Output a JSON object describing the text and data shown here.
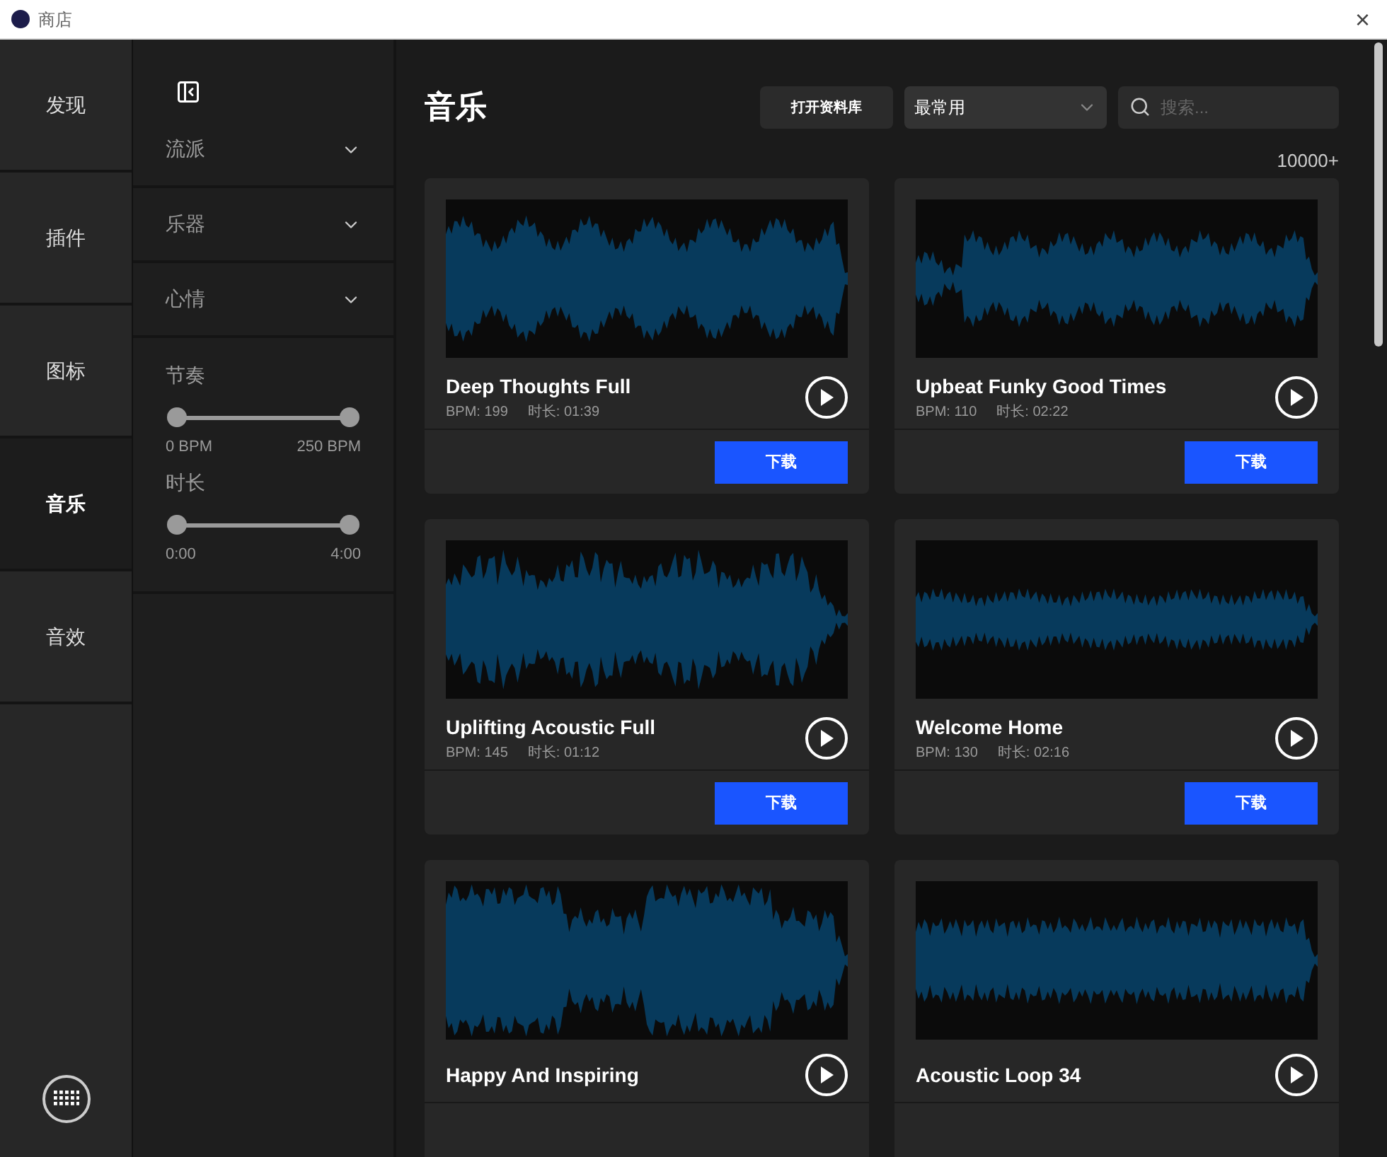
{
  "window": {
    "title": "商店",
    "close": "×"
  },
  "nav": {
    "items": [
      {
        "label": "发现",
        "selected": false
      },
      {
        "label": "插件",
        "selected": false
      },
      {
        "label": "图标",
        "selected": false
      },
      {
        "label": "音乐",
        "selected": true
      },
      {
        "label": "音效",
        "selected": false
      }
    ]
  },
  "filters": {
    "dropdowns": [
      {
        "label": "流派",
        "expanded": false
      },
      {
        "label": "乐器",
        "expanded": false
      },
      {
        "label": "心情",
        "expanded": false
      }
    ],
    "sliders": [
      {
        "label": "节奏",
        "handles": [
          {
            "level": 0
          },
          {
            "level": 1
          }
        ],
        "min": "0 BPM",
        "max": "250 BPM"
      },
      {
        "label": "时长",
        "handles": [
          {
            "level": 0
          },
          {
            "level": 1
          }
        ],
        "min": "0:00",
        "max": "4:00"
      }
    ]
  },
  "main": {
    "title": "音乐",
    "open_library": "打开资料库",
    "sort": {
      "value": "最常用"
    },
    "search": {
      "placeholder": "搜索..."
    },
    "count": "10000+",
    "cards": [
      {
        "title": "Deep Thoughts Full",
        "bpm": "BPM: 199",
        "duration": "时长: 01:39",
        "button": "下载"
      },
      {
        "title": "Upbeat Funky Good Times",
        "bpm": "BPM: 110",
        "duration": "时长: 02:22",
        "button": "下载"
      },
      {
        "title": "Uplifting Acoustic Full",
        "bpm": "BPM: 145",
        "duration": "时长: 01:12",
        "button": "下载"
      },
      {
        "title": "Welcome Home",
        "bpm": "BPM: 130",
        "duration": "时长: 02:16",
        "button": "下载"
      },
      {
        "title": "Happy And Inspiring"
      },
      {
        "title": "Acoustic Loop 34"
      }
    ]
  }
}
